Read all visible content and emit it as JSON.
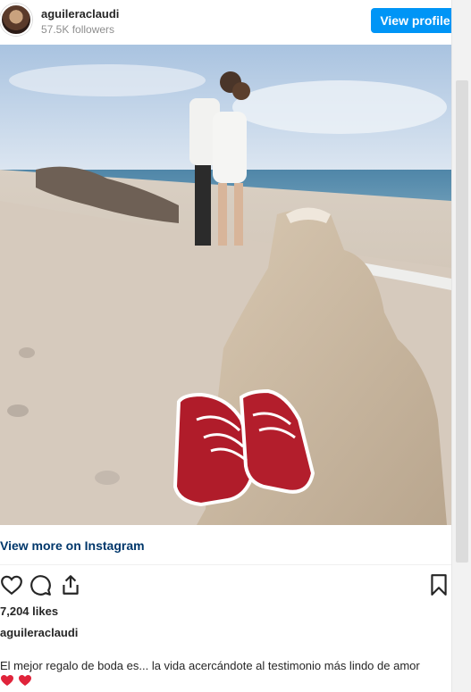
{
  "header": {
    "username": "aguileraclaudi",
    "followers": "57.5K followers",
    "view_profile_label": "View profile"
  },
  "post": {
    "view_more_label": "View more on Instagram",
    "likes": "7,204 likes",
    "caption_username": "aguileraclaudi",
    "caption_text": "El mejor regalo de boda es... la vida acercándote al testimonio más lindo de amor"
  },
  "icons": {
    "like": "heart-icon",
    "comment": "comment-icon",
    "share": "share-icon",
    "save": "bookmark-icon",
    "caption_emoji": "red-hearts-emoji"
  },
  "colors": {
    "accent": "#0095f6",
    "link": "#00376b",
    "text": "#262626",
    "muted": "#8e8e8e"
  }
}
